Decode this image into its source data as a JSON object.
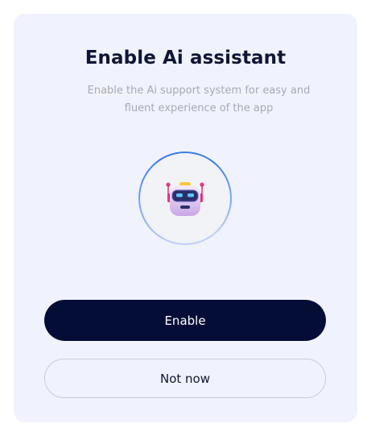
{
  "dialog": {
    "title": "Enable Ai assistant",
    "subtitle": "Enable the Ai support system for easy and fluent experience of the app",
    "illustration_icon": "robot-icon"
  },
  "actions": {
    "enable_label": "Enable",
    "not_now_label": "Not now"
  },
  "colors": {
    "card_background": "#f0f3fe",
    "title": "#0f1535",
    "subtitle": "#a6aab3",
    "primary_button": "#040d36",
    "ring_accent": "#3c7ef0"
  }
}
